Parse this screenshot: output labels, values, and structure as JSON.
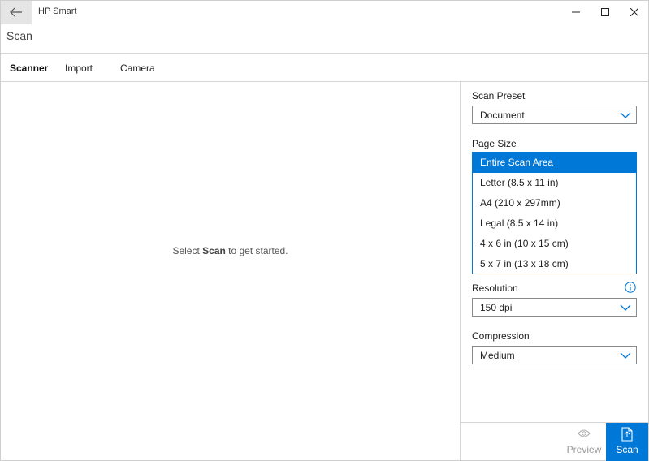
{
  "window": {
    "app_title": "HP Smart",
    "back_icon": "arrow-left-icon",
    "controls": [
      "minimize-icon",
      "maximize-icon",
      "close-icon"
    ]
  },
  "header": {
    "title": "Scan"
  },
  "tabs": [
    {
      "label": "Scanner",
      "active": true
    },
    {
      "label": "Import",
      "active": false
    },
    {
      "label": "Camera",
      "active": false
    }
  ],
  "main": {
    "message_prefix": "Select ",
    "message_bold": "Scan",
    "message_suffix": " to get started."
  },
  "panel": {
    "scan_preset": {
      "label": "Scan Preset",
      "value": "Document"
    },
    "page_size": {
      "label": "Page Size",
      "options": [
        "Entire Scan Area",
        "Letter (8.5 x 11 in)",
        "A4 (210 x 297mm)",
        "Legal (8.5 x 14 in)",
        "4 x 6 in (10 x 15 cm)",
        "5 x 7 in (13 x 18 cm)"
      ],
      "selected": "Entire Scan Area"
    },
    "resolution": {
      "label": "Resolution",
      "value": "150 dpi"
    },
    "compression": {
      "label": "Compression",
      "value": "Medium"
    }
  },
  "actions": {
    "preview_label": "Preview",
    "scan_label": "Scan"
  },
  "colors": {
    "accent": "#0078d7",
    "disabled_text": "#999999"
  }
}
